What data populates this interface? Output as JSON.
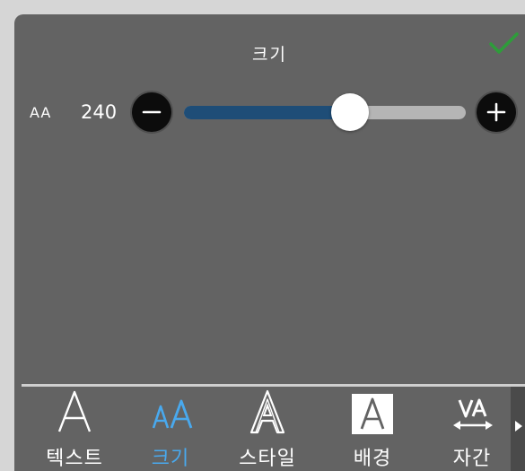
{
  "header": {
    "title": "크기",
    "confirm_icon": "checkmark-icon",
    "confirm_color": "#2e9c3a"
  },
  "size_control": {
    "row_icon": "AA",
    "value": "240",
    "slider_fraction": 0.59,
    "decrease_icon": "minus-icon",
    "increase_icon": "plus-icon",
    "fill_color": "#1e4d77",
    "track_color": "#b5b5b5"
  },
  "tabs": [
    {
      "label": "텍스트",
      "icon": "text-icon",
      "glyph": "A",
      "active": false
    },
    {
      "label": "크기",
      "icon": "size-icon",
      "glyph": "AA",
      "active": true
    },
    {
      "label": "스타일",
      "icon": "style-icon",
      "glyph": "A",
      "active": false
    },
    {
      "label": "배경",
      "icon": "background-icon",
      "glyph": "A",
      "active": false
    },
    {
      "label": "자간",
      "icon": "letter-spacing-icon",
      "glyph": "VA",
      "active": false
    }
  ],
  "more_icon": "chevron-right-icon",
  "accent_color": "#49a9ee"
}
